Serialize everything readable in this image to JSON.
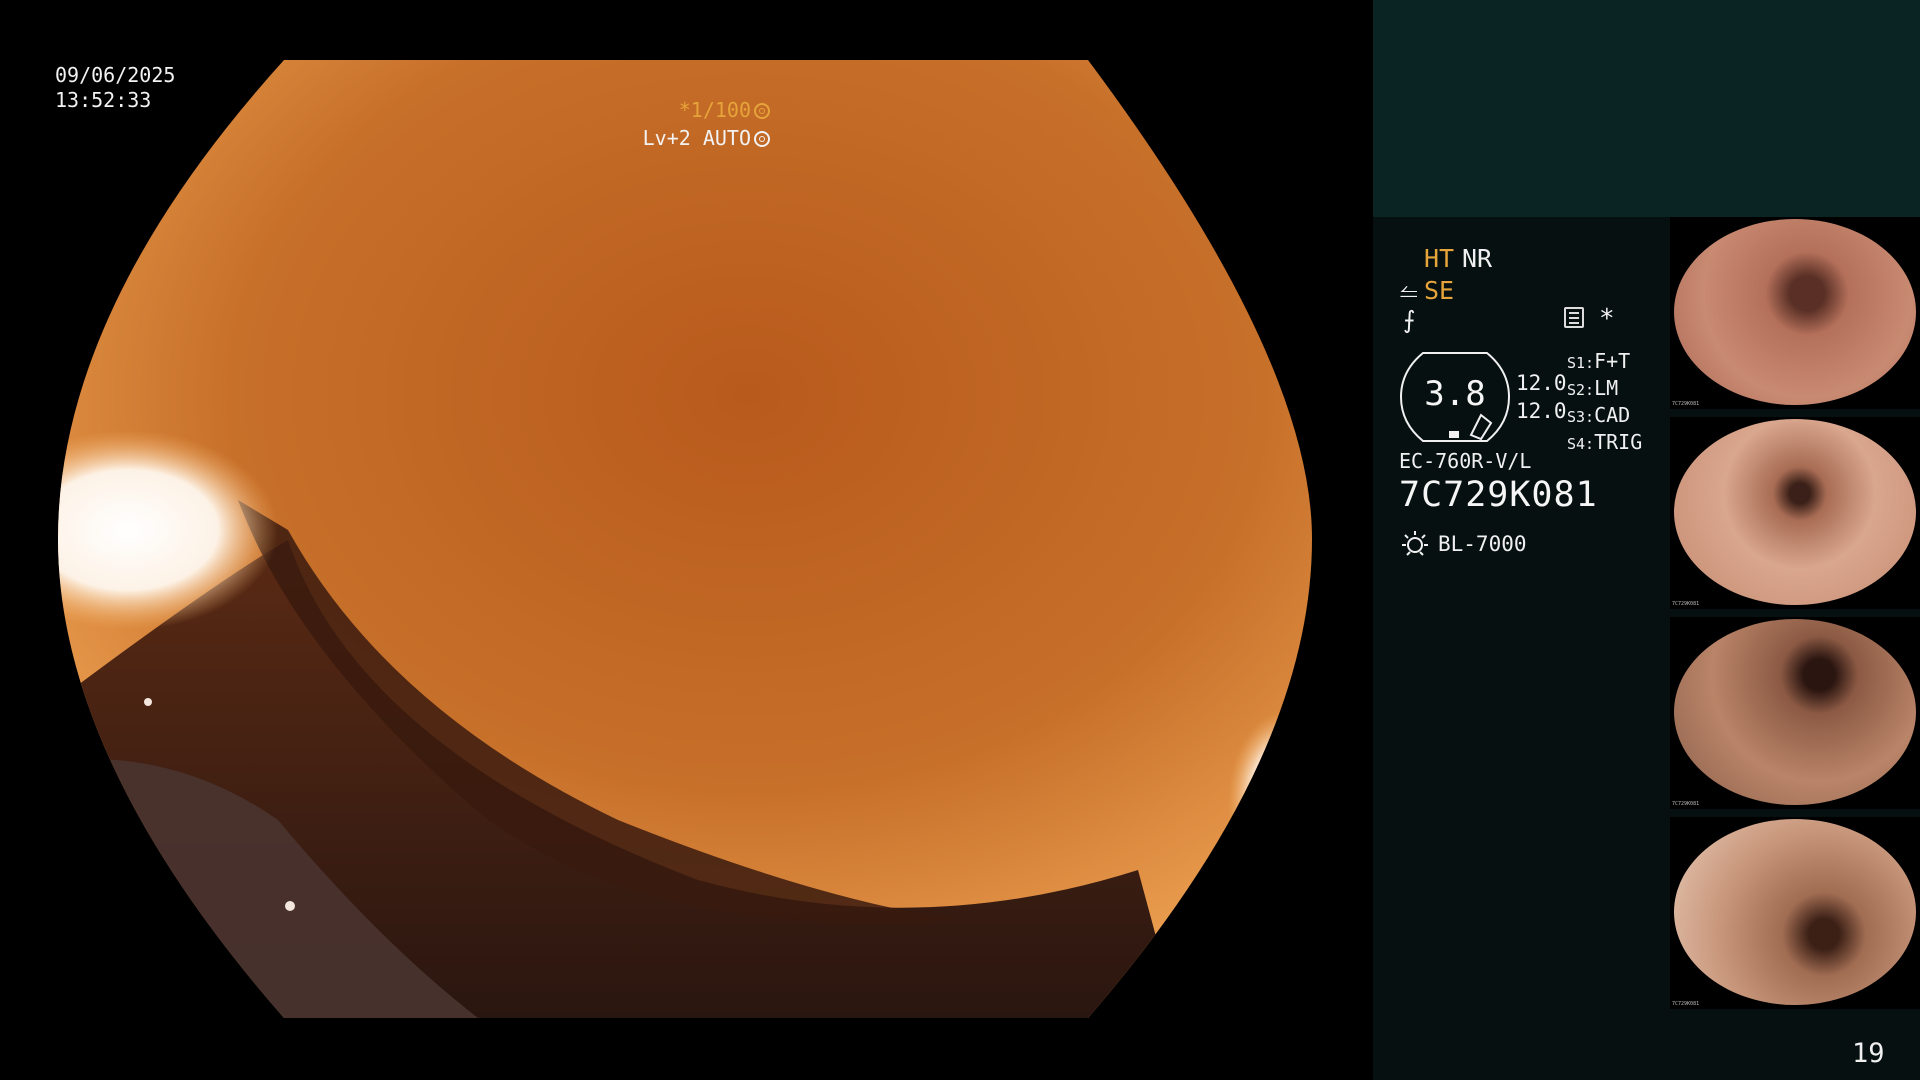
{
  "overlay": {
    "date": "09/06/2025",
    "time": "13:52:33",
    "shutter": "*1/100",
    "level": "Lv+2 AUTO"
  },
  "panel": {
    "ht": "HT",
    "nr": "NR",
    "se": "SE",
    "gauge_value": "3.8",
    "value_1": "12.0",
    "value_2": "12.0",
    "slots": [
      {
        "key": "S1:",
        "value": "F+T"
      },
      {
        "key": "S2:",
        "value": "LM"
      },
      {
        "key": "S3:",
        "value": "CAD"
      },
      {
        "key": "S4:",
        "value": "TRIG"
      }
    ],
    "model": "EC-760R-V/L",
    "serial": "7C729K081",
    "light_source": "BL-7000",
    "page_number": "19"
  },
  "thumbnails": [
    {
      "label": "7C729K081"
    },
    {
      "label": "7C729K081"
    },
    {
      "label": "7C729K081"
    },
    {
      "label": "7C729K081"
    }
  ],
  "colors": {
    "accent_orange": "#e6a43a",
    "panel_bg": "#061010",
    "panel_top": "#0a2424"
  }
}
